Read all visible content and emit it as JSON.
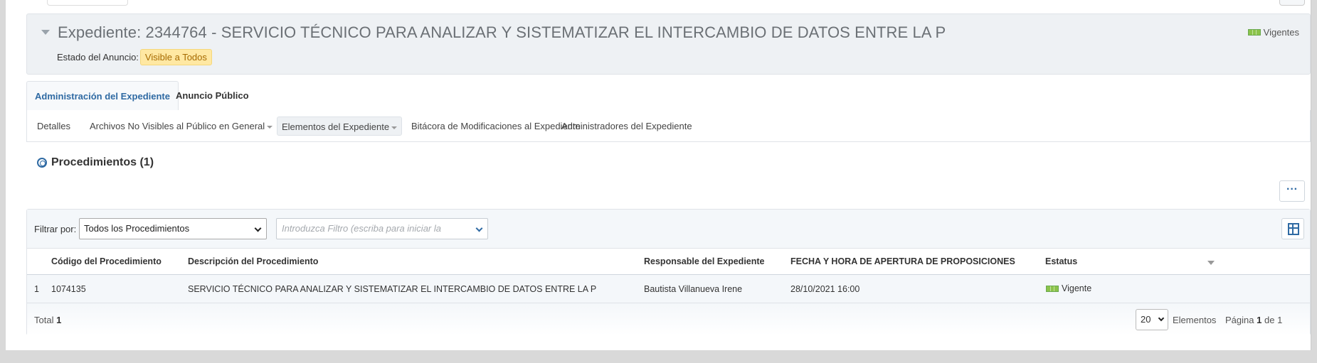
{
  "expediente": {
    "title": "Expediente: 2344764 - SERVICIO TÉCNICO PARA ANALIZAR Y SISTEMATIZAR EL INTERCAMBIO DE DATOS ENTRE LA P",
    "status": "Vigentes",
    "announcement_label": "Estado del Anuncio:",
    "announcement_value": "Visible a Todos"
  },
  "tabs": [
    {
      "label": "Administración del Expediente",
      "active": true
    },
    {
      "label": "Anuncio Público",
      "active": false
    }
  ],
  "subnav": [
    {
      "label": "Detalles"
    },
    {
      "label": "Archivos No Visibles al Público en General",
      "dropdown": true
    },
    {
      "label": "Elementos del Expediente",
      "dropdown": true,
      "selected": true
    },
    {
      "label": "Bitácora de Modificaciones al Expediente"
    },
    {
      "label": "Administradores del Expediente"
    }
  ],
  "section": {
    "title": "Procedimientos (1)",
    "more_label": "···"
  },
  "filter": {
    "label": "Filtrar por:",
    "select_value": "Todos los Procedimientos",
    "input_placeholder": "Introduzca Filtro (escriba para iniciar la"
  },
  "table": {
    "columns": [
      "Código del Procedimiento",
      "Descripción del Procedimiento",
      "Responsable del Expediente",
      "FECHA Y HORA DE APERTURA DE PROPOSICIONES",
      "Estatus"
    ],
    "rows": [
      {
        "index": "1",
        "code": "1074135",
        "description": "SERVICIO TÉCNICO PARA ANALIZAR Y SISTEMATIZAR EL INTERCAMBIO DE DATOS ENTRE LA P",
        "responsible": "Bautista Villanueva Irene",
        "opening": "28/10/2021 16:00",
        "status": "Vigente"
      }
    ]
  },
  "footer": {
    "total_label": "Total",
    "total_value": "1",
    "page_size": "20",
    "elements_label": "Elementos",
    "page_label": "Página",
    "page_current": "1",
    "page_of": "de",
    "page_total": "1"
  },
  "colors": {
    "accent": "#2f6aa3",
    "badge_bg": "#ffe8a3",
    "status_green": "#8bc34a"
  }
}
